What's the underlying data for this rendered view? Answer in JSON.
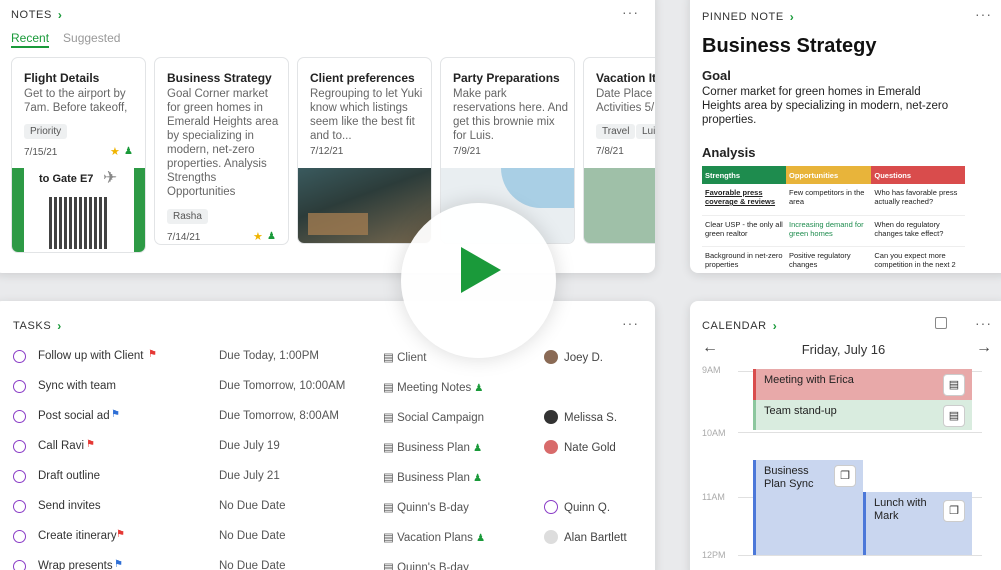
{
  "notes": {
    "header": "NOTES",
    "tabs": [
      "Recent",
      "Suggested"
    ],
    "cards": [
      {
        "title": "Flight Details",
        "body": "Get to the airport by 7am. Before takeoff,",
        "tag": "Priority",
        "date": "7/15/21",
        "ticket": "to Gate E7"
      },
      {
        "title": "Business Strategy",
        "body": "Goal Corner market for green homes in Emerald Heights area by specializing in modern, net-zero properties. Analysis Strengths Opportunities",
        "tag": "Rasha",
        "date": "7/14/21"
      },
      {
        "title": "Client preferences",
        "body": "Regrouping to let Yuki know which listings seem like the best fit and to...",
        "date": "7/12/21"
      },
      {
        "title": "Party Preparations",
        "body": "Make park reservations here. And get this brownie mix for Luis.",
        "date": "7/9/21"
      },
      {
        "title": "Vacation Iti",
        "body": "Date Place I Activities 5/",
        "tags": [
          "Travel",
          "Luis"
        ],
        "date": "7/8/21"
      }
    ]
  },
  "pinned": {
    "header": "PINNED NOTE",
    "title": "Business Strategy",
    "goal_label": "Goal",
    "goal_body": "Corner market for green homes in Emerald Heights area by specializing in modern, net-zero properties.",
    "analysis_label": "Analysis",
    "table": {
      "headers": [
        "Strengths",
        "Opportunities",
        "Questions"
      ],
      "header_colors": [
        "#1e8c4e",
        "#e8b43a",
        "#d94c4c"
      ],
      "rows": [
        [
          "Favorable press coverage & reviews",
          "Few competitors in the area",
          "Who has favorable press actually reached?"
        ],
        [
          "Clear USP - the only all green realtor",
          "Increasing demand for green homes",
          "When do regulatory changes take effect?"
        ],
        [
          "Background in net-zero properties",
          "Positive regulatory changes",
          "Can you expect more competition in the next 2"
        ]
      ]
    }
  },
  "tasks": {
    "header": "TASKS",
    "rows": [
      {
        "name": "Follow up with Client",
        "flag": "red",
        "due": "Due Today, 1:00PM",
        "notebook": "Client",
        "assignee": "Joey D."
      },
      {
        "name": "Sync with team",
        "due": "Due Tomorrow, 10:00AM",
        "notebook": "Meeting Notes",
        "shared": true,
        "assignee": ""
      },
      {
        "name": "Post social ad",
        "flag": "blue",
        "due": "Due Tomorrow, 8:00AM",
        "notebook": "Social Campaign",
        "assignee": "Melissa S."
      },
      {
        "name": "Call Ravi",
        "flag": "red",
        "due": "Due July 19",
        "notebook": "Business Plan",
        "shared": true,
        "assignee": "Nate Gold"
      },
      {
        "name": "Draft outline",
        "due": "Due July 21",
        "notebook": "Business Plan",
        "shared": true,
        "assignee": ""
      },
      {
        "name": "Send invites",
        "due": "No Due Date",
        "notebook": "Quinn's B-day",
        "assignee": "Quinn Q."
      },
      {
        "name": "Create itinerary",
        "flag": "red",
        "due": "No Due Date",
        "notebook": "Vacation Plans",
        "shared": true,
        "assignee": "Alan Bartlett"
      },
      {
        "name": "Wrap presents",
        "flag": "blue",
        "due": "No Due Date",
        "notebook": "Quinn's B-day",
        "assignee": ""
      }
    ]
  },
  "calendar": {
    "header": "CALENDAR",
    "date": "Friday, July 16",
    "times": [
      "9AM",
      "10AM",
      "11AM",
      "12PM"
    ],
    "events": [
      {
        "title": "Meeting with Erica",
        "color": "#e8a9a9",
        "bar": "#d94c4c"
      },
      {
        "title": "Team stand-up",
        "color": "#d9ecdf",
        "bar": "#8cc79e"
      },
      {
        "title": "Business Plan Sync",
        "color": "#c9d6ef",
        "bar": "#4c78d9"
      },
      {
        "title": "Lunch with Mark",
        "color": "#c9d6ef",
        "bar": "#4c78d9"
      }
    ]
  },
  "colors": {
    "accent": "#1a9a3a",
    "task_circle": "#8a3cc7"
  }
}
